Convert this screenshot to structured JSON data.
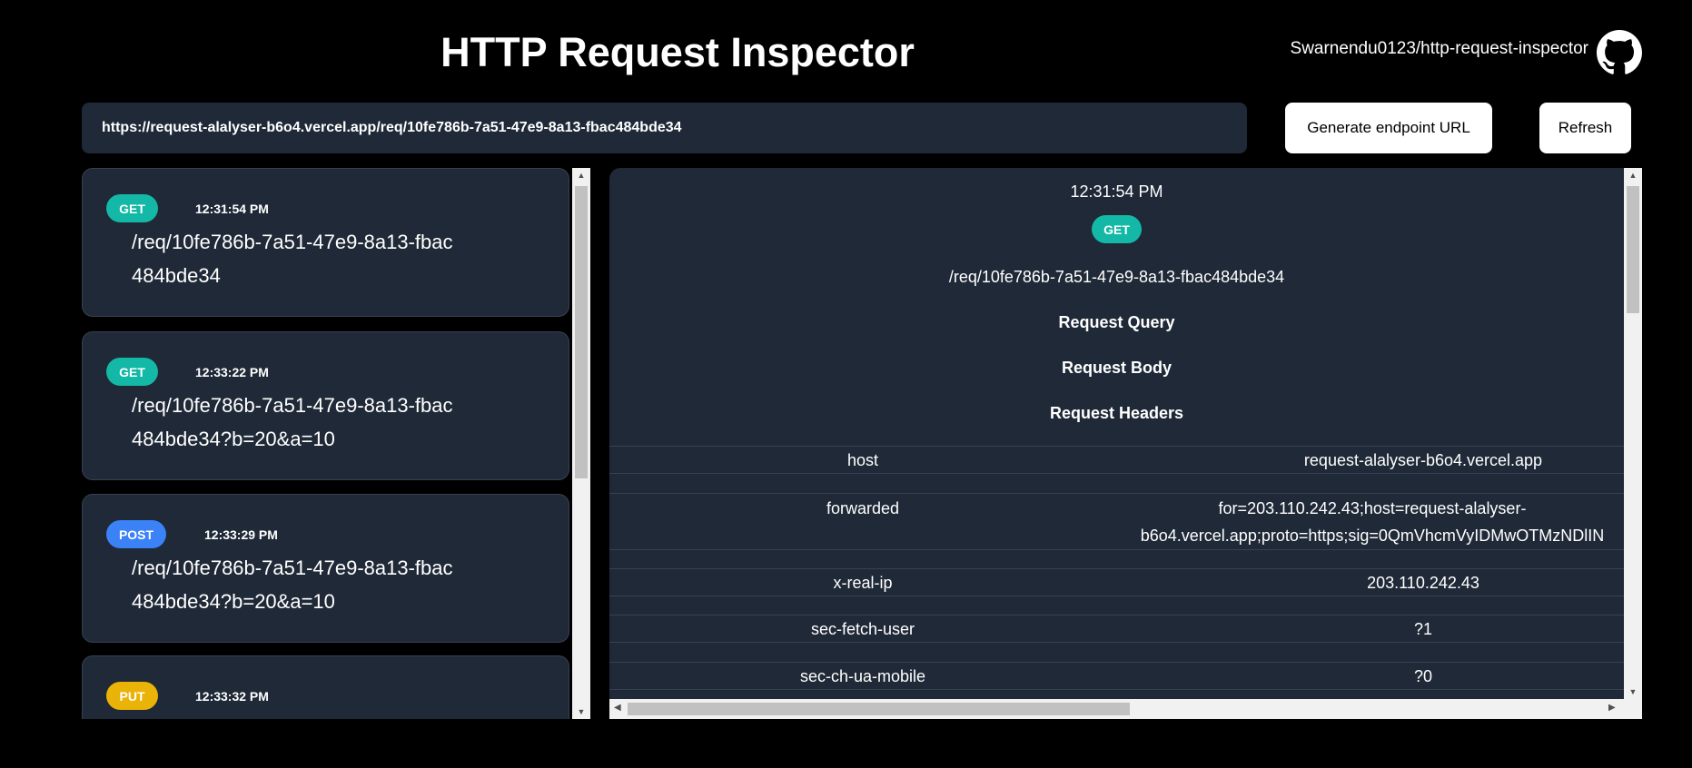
{
  "header": {
    "title": "HTTP Request Inspector",
    "repo_link": "Swarnendu0123/http-request-inspector",
    "github_icon": "github-icon"
  },
  "endpoint_url": "https://request-alalyser-b6o4.vercel.app/req/10fe786b-7a51-47e9-8a13-fbac484bde34",
  "buttons": {
    "generate": "Generate endpoint URL",
    "refresh": "Refresh"
  },
  "colors": {
    "GET": "#14b8a6",
    "POST": "#3b82f6",
    "PUT": "#eab308",
    "panel": "#1f2937"
  },
  "requests": [
    {
      "method": "GET",
      "time": "12:31:54 PM",
      "path": "/req/10fe786b-7a51-47e9-8a13-fbac484bde34"
    },
    {
      "method": "GET",
      "time": "12:33:22 PM",
      "path": "/req/10fe786b-7a51-47e9-8a13-fbac484bde34?b=20&a=10"
    },
    {
      "method": "POST",
      "time": "12:33:29 PM",
      "path": "/req/10fe786b-7a51-47e9-8a13-fbac484bde34?b=20&a=10"
    },
    {
      "method": "PUT",
      "time": "12:33:32 PM",
      "path": ""
    }
  ],
  "detail": {
    "time": "12:31:54 PM",
    "method": "GET",
    "path": "/req/10fe786b-7a51-47e9-8a13-fbac484bde34",
    "query_heading": "Request Query",
    "body_heading": "Request Body",
    "headers_heading": "Request Headers",
    "headers": [
      {
        "key": "host",
        "value": "request-alalyser-b6o4.vercel.app"
      },
      {
        "key": "forwarded",
        "value": "for=203.110.242.43;host=request-alalyser-b6o4.vercel.app;proto=https;sig=0QmVhcmVyIDMwOTMzNDlIN"
      },
      {
        "key": "x-real-ip",
        "value": "203.110.242.43"
      },
      {
        "key": "sec-fetch-user",
        "value": "?1"
      },
      {
        "key": "sec-ch-ua-mobile",
        "value": "?0"
      }
    ]
  }
}
